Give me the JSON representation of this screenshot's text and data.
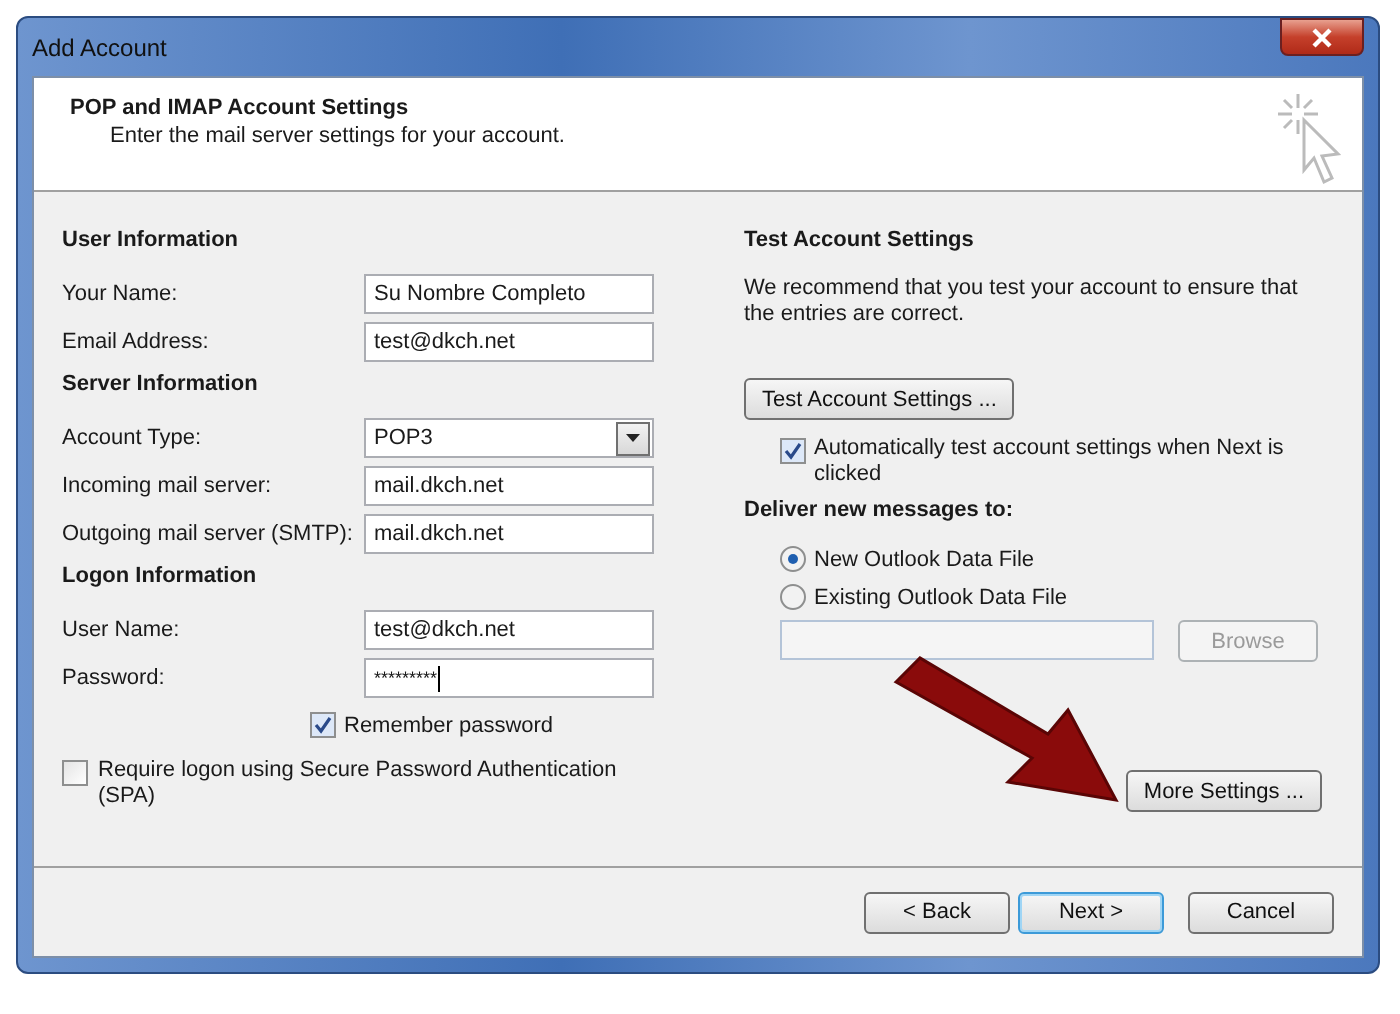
{
  "window": {
    "title": "Add Account"
  },
  "header": {
    "title": "POP and IMAP Account Settings",
    "subtitle": "Enter the mail server settings for your account."
  },
  "left_sections": [
    {
      "heading": "User Information",
      "fields": [
        {
          "label": "Your Name:",
          "value": "Su Nombre Completo",
          "kind": "text"
        },
        {
          "label": "Email Address:",
          "value": "test@dkch.net",
          "kind": "text"
        }
      ]
    },
    {
      "heading": "Server Information",
      "fields": [
        {
          "label": "Account Type:",
          "value": "POP3",
          "kind": "dropdown"
        },
        {
          "label": "Incoming mail server:",
          "value": "mail.dkch.net",
          "kind": "text"
        },
        {
          "label": "Outgoing mail server (SMTP):",
          "value": "mail.dkch.net",
          "kind": "text"
        }
      ]
    },
    {
      "heading": "Logon Information",
      "fields": [
        {
          "label": "User Name:",
          "value": "test@dkch.net",
          "kind": "text"
        },
        {
          "label": "Password:",
          "value": "*********",
          "kind": "password"
        }
      ]
    }
  ],
  "remember_password": {
    "label": "Remember password",
    "checked": true
  },
  "require_spa": {
    "label": "Require logon using Secure Password Authentication (SPA)",
    "checked": false
  },
  "test_settings": {
    "heading": "Test Account Settings",
    "description": "We recommend that you test your account to ensure that the entries are correct.",
    "button": "Test Account Settings ...",
    "auto_test": {
      "label": "Automatically test account settings when Next is clicked",
      "checked": true
    }
  },
  "deliver": {
    "heading": "Deliver new messages to:",
    "options": [
      {
        "label": "New Outlook Data File",
        "selected": true
      },
      {
        "label": "Existing Outlook Data File",
        "selected": false
      }
    ],
    "browse": {
      "label": "Browse",
      "disabled": true
    }
  },
  "more_settings": "More Settings ...",
  "buttons": [
    {
      "label": "< Back",
      "default": false
    },
    {
      "label": "Next >",
      "default": true
    },
    {
      "label": "Cancel",
      "default": false
    }
  ]
}
